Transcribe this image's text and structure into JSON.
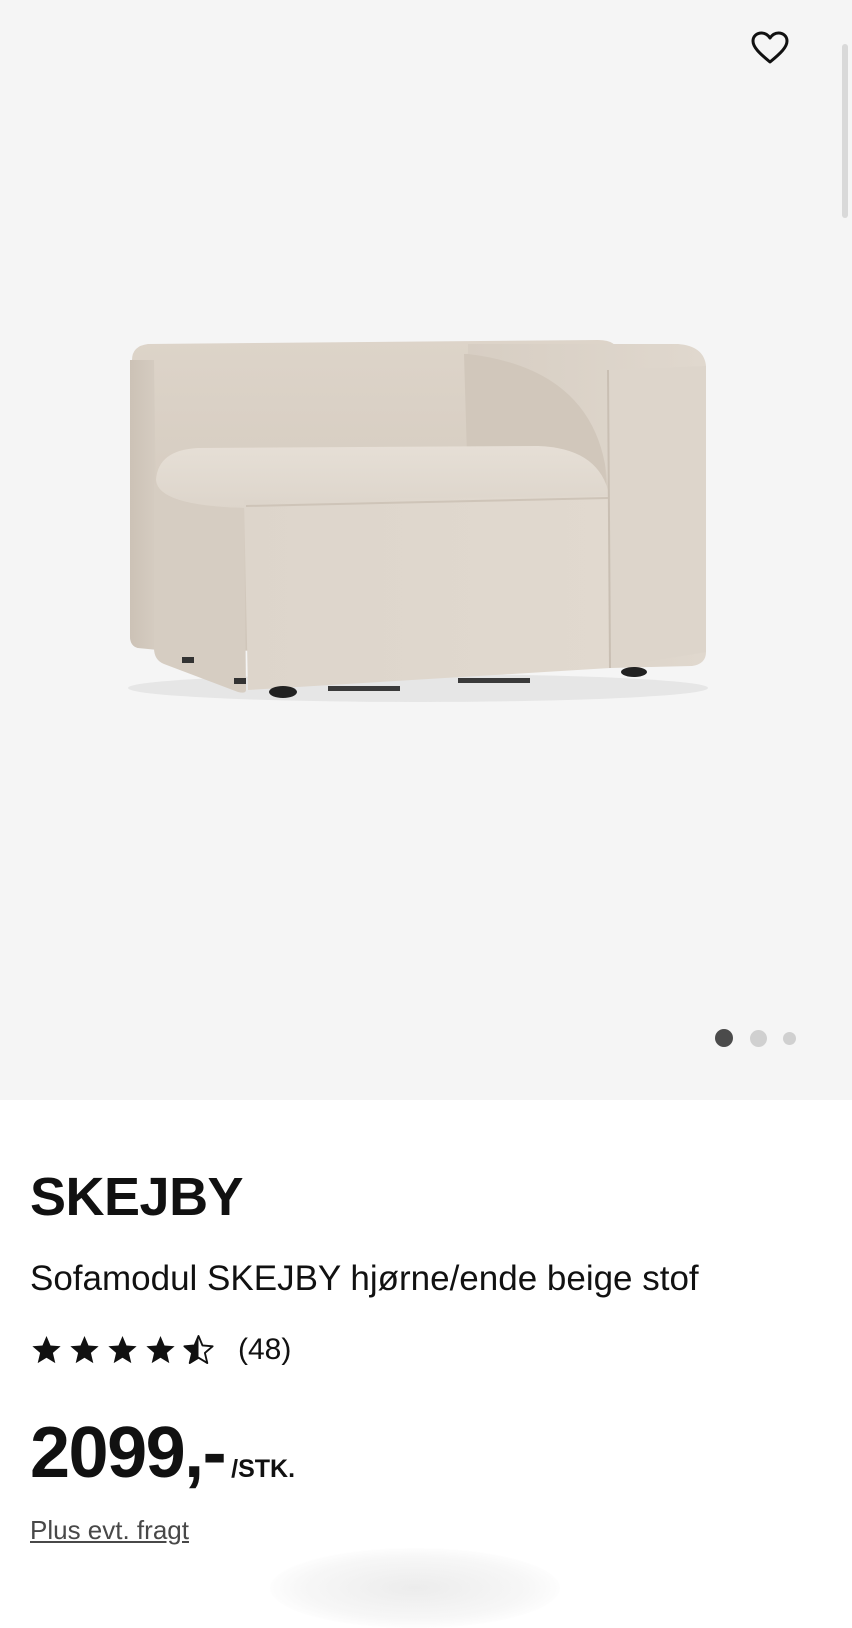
{
  "gallery": {
    "image_alt": "Sofamodul SKEJBY hjørne/ende beige stof",
    "slides": 3,
    "active_slide": 1
  },
  "icons": {
    "favorite": "heart-outline-icon",
    "rating_full": "star-filled-icon",
    "rating_half": "star-half-icon"
  },
  "product": {
    "name": "SKEJBY",
    "description": "Sofamodul SKEJBY hjørne/ende beige stof",
    "rating_value": 4.5,
    "rating_max": 5,
    "review_count": "(48)",
    "price": "2099,-",
    "price_unit": "/STK.",
    "shipping_note": "Plus evt. fragt"
  },
  "colors": {
    "gallery_bg": "#f5f5f5",
    "text": "#111111",
    "sofa_fabric": "#dcd3c8",
    "active_dot": "#4b4b4b",
    "inactive_dot": "#d0d0d0"
  }
}
